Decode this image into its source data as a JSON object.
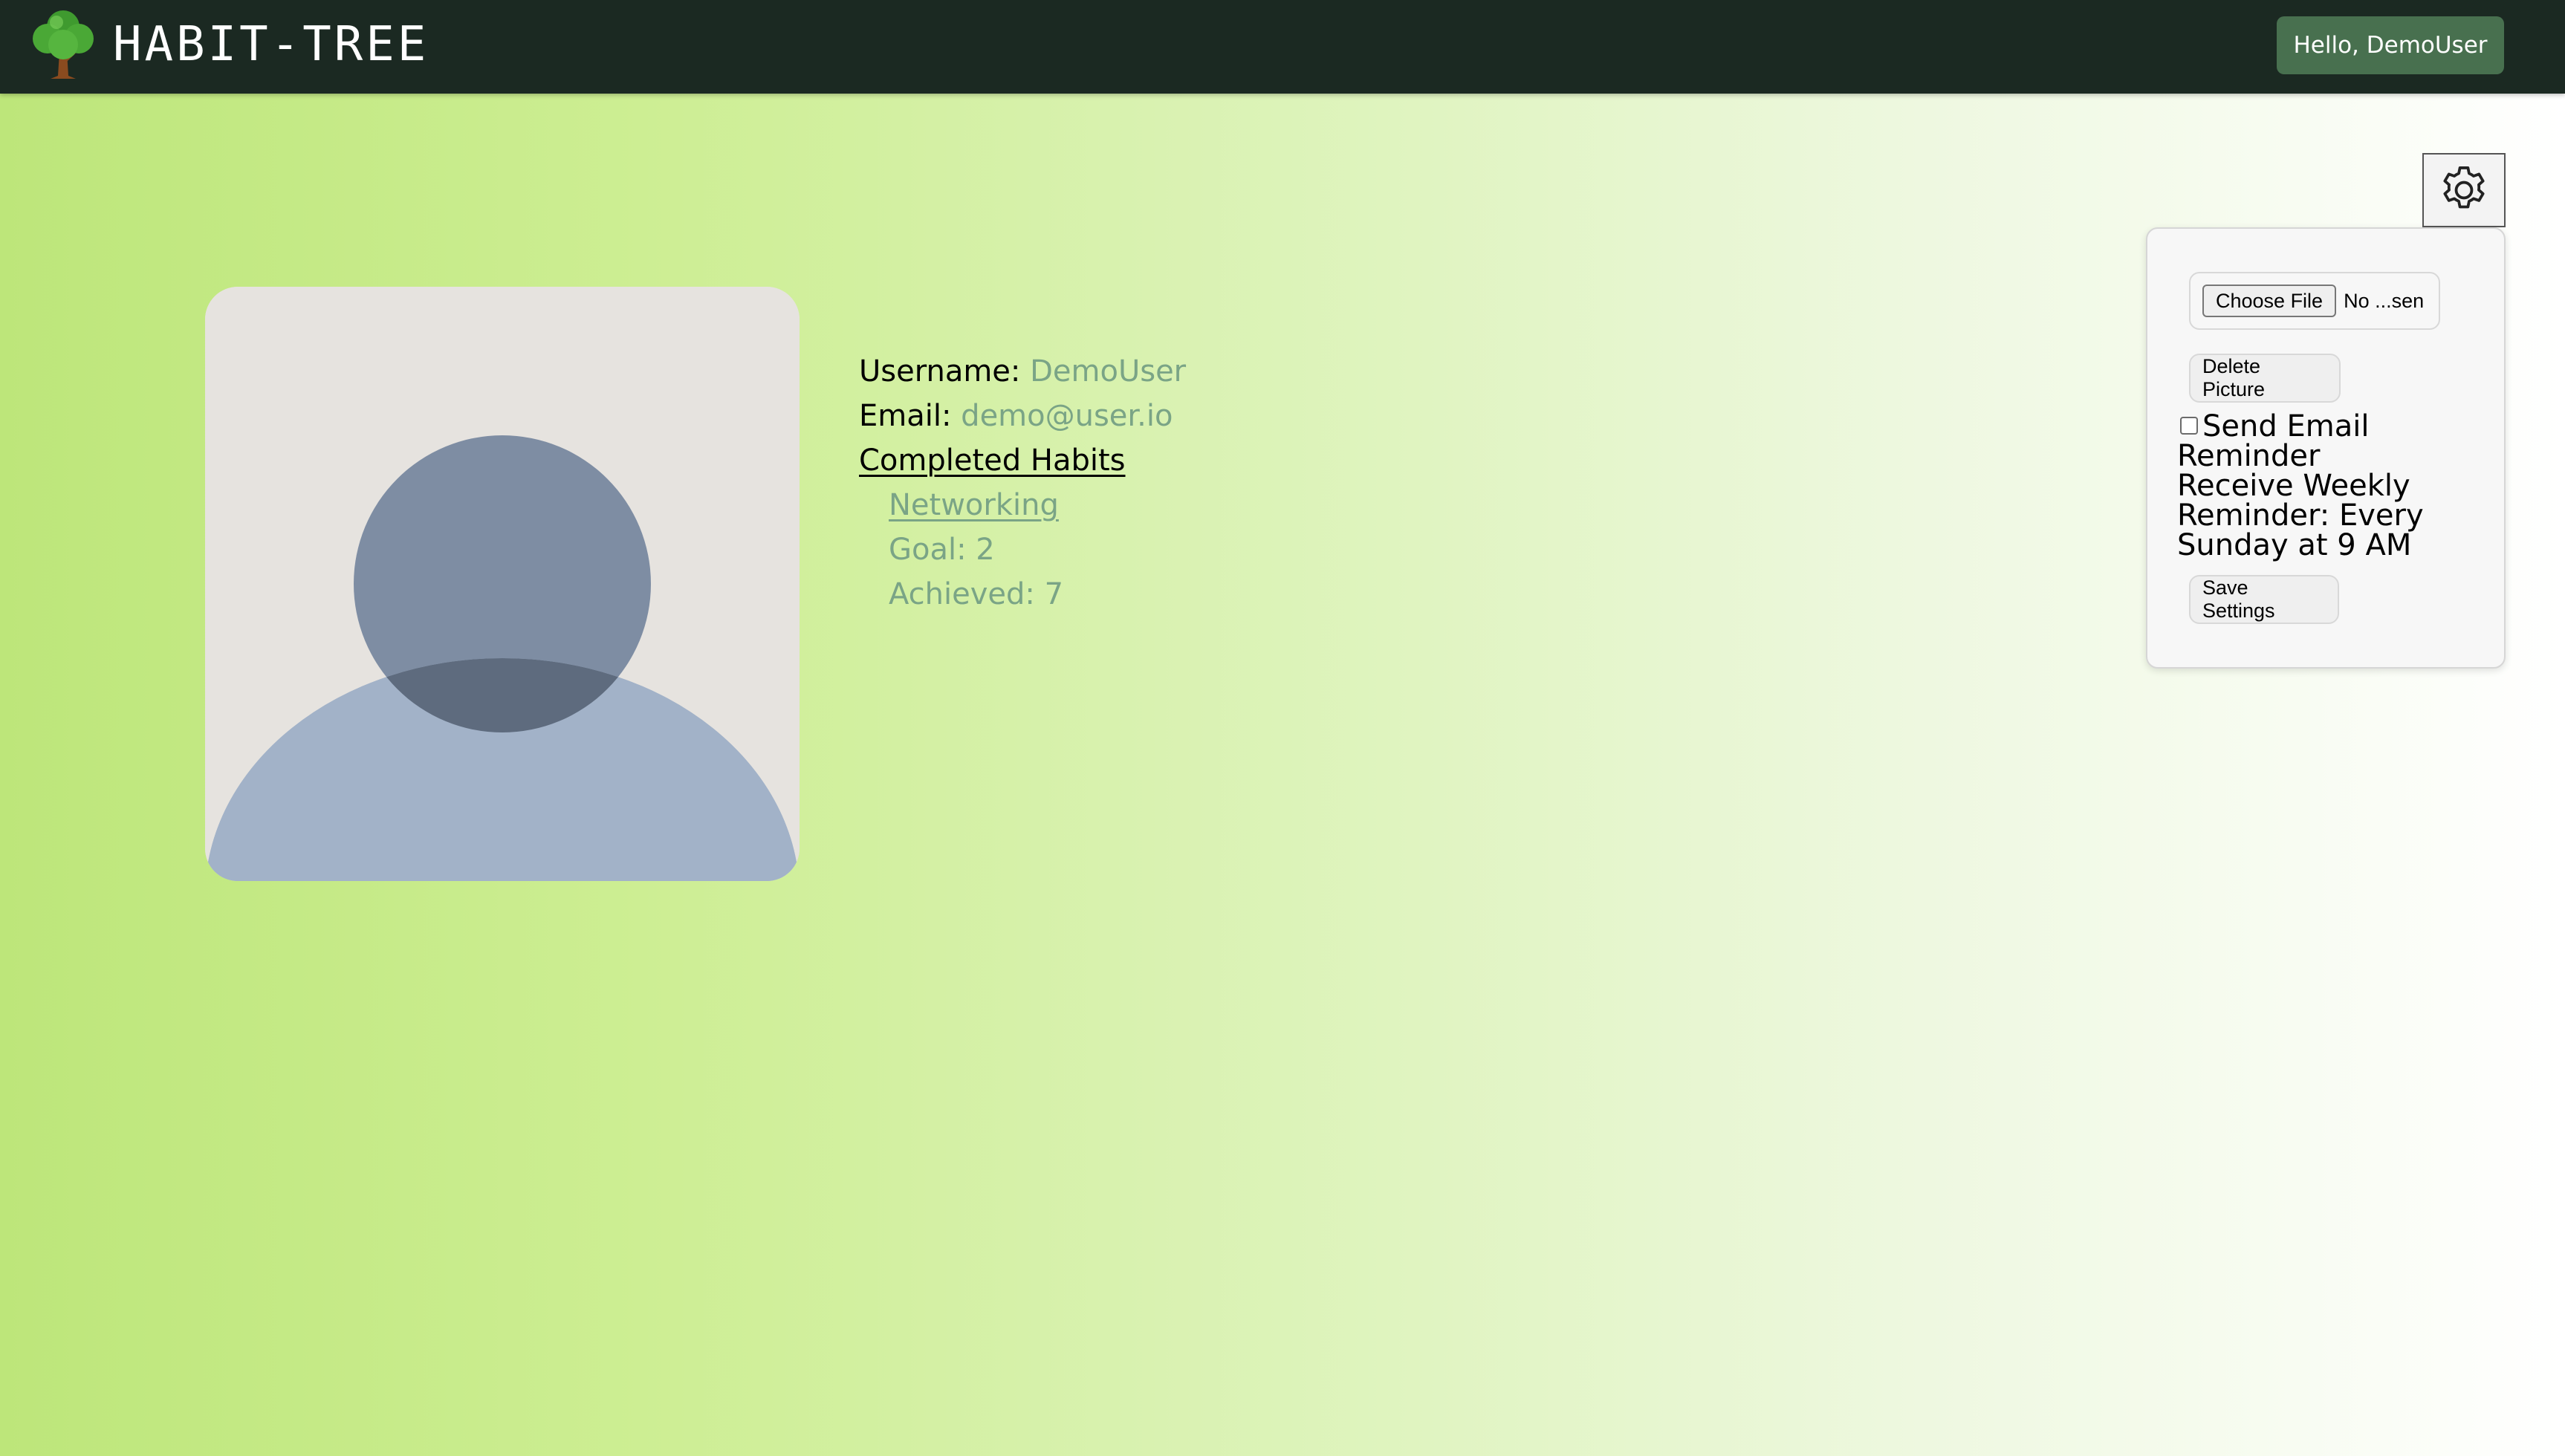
{
  "header": {
    "brand": "HABIT-TREE",
    "greeting_button": "Hello, DemoUser",
    "logo_icon": "tree-icon"
  },
  "profile": {
    "avatar_icon": "default-avatar-icon",
    "username_label": "Username:",
    "username_value": "DemoUser",
    "email_label": "Email:",
    "email_value": "demo@user.io",
    "completed_habits_title": "Completed Habits",
    "habits": [
      {
        "name": "Networking",
        "goal": "Goal: 2",
        "achieved": "Achieved: 7"
      }
    ]
  },
  "settings": {
    "gear_icon": "gear-icon",
    "choose_file_label": "Choose File",
    "file_status": "No ...sen",
    "delete_picture_label": "Delete Picture",
    "send_email_label": "Send Email Reminder",
    "send_email_checked": false,
    "reminder_text": "Receive Weekly Reminder: Every Sunday at 9 AM",
    "save_settings_label": "Save Settings"
  },
  "colors": {
    "navbar": "#1b2922",
    "greeting_button": "#48704f",
    "accent_text": "#7aa486",
    "background_start": "#bde67a",
    "background_end": "#ffffff"
  }
}
